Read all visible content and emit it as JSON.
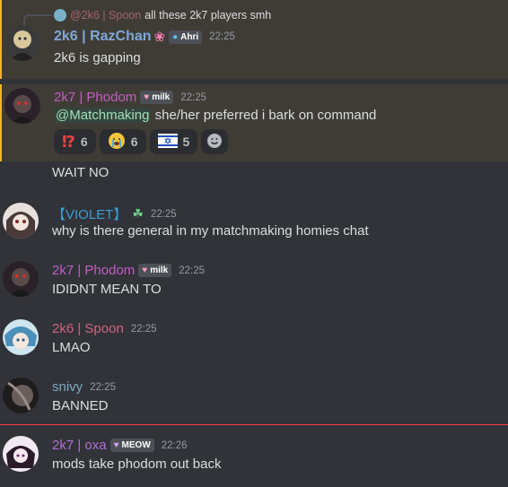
{
  "reply": {
    "mention": "@2k6 | Spoon",
    "text": "all these 2k7 players smh"
  },
  "messages": [
    {
      "author": "2k6 | RazChan",
      "author_suffix": "❀",
      "badge": "Ahri",
      "time": "22:25",
      "text": "2k6 is gapping",
      "name_color": "#7fa8d8"
    },
    {
      "author": "2k7 | Phodom",
      "badge": "milk",
      "time": "22:25",
      "mention": "@Matchmaking",
      "text": "she/her preferred i bark on command",
      "name_color": "#c45cc4",
      "reactions": [
        {
          "emoji": "⁉",
          "count": "6",
          "color": "#f23f43"
        },
        {
          "emoji": "😭",
          "count": "6"
        },
        {
          "emoji": "flag",
          "count": "5"
        }
      ]
    },
    {
      "text": "WAIT NO"
    },
    {
      "author": "【VIOLET】",
      "time": "22:25",
      "text": "why is there general in my matchmaking homies chat",
      "name_color": "#3b9ed8"
    },
    {
      "author": "2k7 | Phodom",
      "badge": "milk",
      "time": "22:25",
      "text": "IDIDNT MEAN TO",
      "name_color": "#c45cc4"
    },
    {
      "author": "2k6 | Spoon",
      "time": "22:25",
      "text": "LMAO",
      "name_color": "#d0637f"
    },
    {
      "author": "snivy",
      "time": "22:25",
      "text": "BANNED",
      "name_color": "#7fa8c4"
    },
    {
      "author": "2k7 | oxa",
      "badge": "MEOW",
      "time": "22:26",
      "text": "mods take phodom out back",
      "name_color": "#b06fd8"
    }
  ]
}
